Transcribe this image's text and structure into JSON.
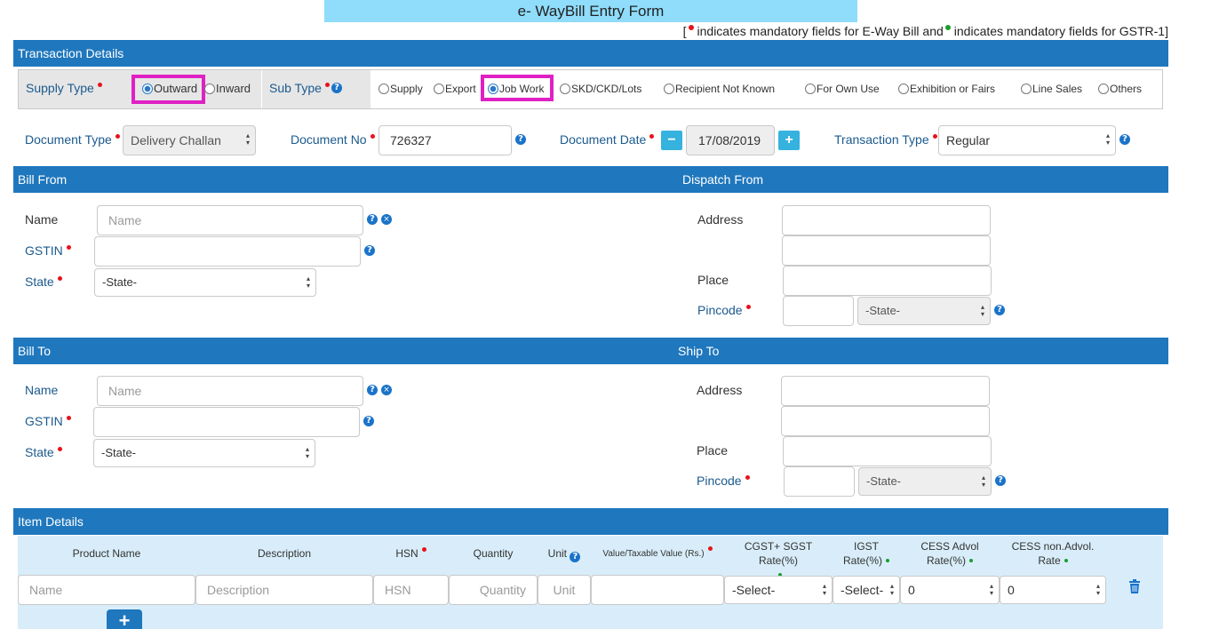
{
  "form_title": "e- WayBill Entry Form",
  "legend": {
    "open": "[",
    "part1": "indicates mandatory fields for E-Way Bill and",
    "part2": "indicates mandatory fields for GSTR-1]"
  },
  "sections": {
    "transaction": "Transaction Details",
    "bill_from": "Bill From",
    "dispatch_from": "Dispatch From",
    "bill_to": "Bill To",
    "ship_to": "Ship To",
    "items": "Item Details"
  },
  "supply_type": {
    "label": "Supply Type",
    "options": [
      "Outward",
      "Inward"
    ],
    "selected": "Outward"
  },
  "sub_type": {
    "label": "Sub Type",
    "options": [
      "Supply",
      "Export",
      "Job Work",
      "SKD/CKD/Lots",
      "Recipient Not Known",
      "For Own Use",
      "Exhibition or Fairs",
      "Line Sales",
      "Others"
    ],
    "selected": "Job Work"
  },
  "document": {
    "type_label": "Document Type",
    "type_value": "Delivery Challan",
    "no_label": "Document No",
    "no_value": "726327",
    "date_label": "Document Date",
    "date_value": "17/08/2019",
    "transaction_type_label": "Transaction Type",
    "transaction_type_value": "Regular"
  },
  "bill_from": {
    "name_label": "Name",
    "name_placeholder": "Name",
    "gstin_label": "GSTIN",
    "state_label": "State",
    "state_value": "-State-"
  },
  "dispatch_from": {
    "address_label": "Address",
    "place_label": "Place",
    "pincode_label": "Pincode",
    "state_value": "-State-"
  },
  "bill_to": {
    "name_label": "Name",
    "name_placeholder": "Name",
    "gstin_label": "GSTIN",
    "state_label": "State",
    "state_value": "-State-"
  },
  "ship_to": {
    "address_label": "Address",
    "place_label": "Place",
    "pincode_label": "Pincode",
    "state_value": "-State-"
  },
  "items": {
    "headers": {
      "product": "Product Name",
      "description": "Description",
      "hsn": "HSN",
      "quantity": "Quantity",
      "unit": "Unit",
      "value": "Value/Taxable Value (Rs.)",
      "cgst_sgst": "CGST+ SGST Rate(%)",
      "igst_1": "IGST",
      "igst_2": "Rate(%)",
      "cess_advol_1": "CESS Advol",
      "cess_advol_2": "Rate(%)",
      "cess_nonadvol_1": "CESS non.Advol.",
      "cess_nonadvol_2": "Rate"
    },
    "row": {
      "product_placeholder": "Name",
      "description_placeholder": "Description",
      "hsn_placeholder": "HSN",
      "quantity_placeholder": "Quantity",
      "unit_placeholder": "Unit",
      "cgst_value": "-Select-",
      "igst_value": "-Select-",
      "cess_advol_value": "0",
      "cess_nonadvol_value": "0"
    },
    "add_label": "+"
  },
  "icons": {
    "help": "?",
    "clear": "×",
    "minus": "−",
    "plus": "+",
    "trash": "trash-icon"
  },
  "colors": {
    "section_bar": "#1f77bd",
    "title_bg": "#8fdcfb",
    "highlight": "#e020c4",
    "mandatory_ewb": "#e8121a",
    "mandatory_gstr": "#1a9e2c"
  }
}
